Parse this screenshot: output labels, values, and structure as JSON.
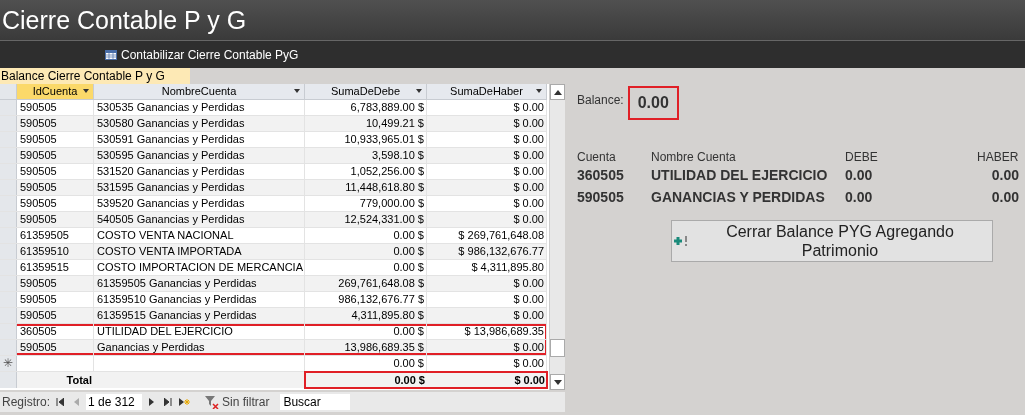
{
  "window": {
    "title": "Cierre Contable P y G"
  },
  "toolbar": {
    "button": "Contabilizar Cierre Contable PyG"
  },
  "form_tab": {
    "label": "Balance Cierre Contable P y G"
  },
  "table": {
    "columns": [
      {
        "label": "IdCuenta",
        "selected": true
      },
      {
        "label": "NombreCuenta",
        "selected": false
      },
      {
        "label": "SumaDeDebe",
        "selected": false
      },
      {
        "label": "SumaDeHaber",
        "selected": false
      }
    ],
    "rows": [
      {
        "cells": [
          "590505",
          "530535 Ganancias y Perdidas",
          "6,783,889.00 $",
          "$ 0.00"
        ],
        "highlighted": false
      },
      {
        "cells": [
          "590505",
          "530580 Ganancias y Perdidas",
          "10,499.21 $",
          "$ 0.00"
        ],
        "highlighted": false
      },
      {
        "cells": [
          "590505",
          "530591 Ganancias y Perdidas",
          "10,933,965.01 $",
          "$ 0.00"
        ],
        "highlighted": false
      },
      {
        "cells": [
          "590505",
          "530595 Ganancias y Perdidas",
          "3,598.10 $",
          "$ 0.00"
        ],
        "highlighted": false
      },
      {
        "cells": [
          "590505",
          "531520 Ganancias y Perdidas",
          "1,052,256.00 $",
          "$ 0.00"
        ],
        "highlighted": false
      },
      {
        "cells": [
          "590505",
          "531595 Ganancias y Perdidas",
          "11,448,618.80 $",
          "$ 0.00"
        ],
        "highlighted": false
      },
      {
        "cells": [
          "590505",
          "539520 Ganancias y Perdidas",
          "779,000.00 $",
          "$ 0.00"
        ],
        "highlighted": false
      },
      {
        "cells": [
          "590505",
          "540505 Ganancias y Perdidas",
          "12,524,331.00 $",
          "$ 0.00"
        ],
        "highlighted": false
      },
      {
        "cells": [
          "61359505",
          "COSTO VENTA NACIONAL",
          "0.00 $",
          "$ 269,761,648.08"
        ],
        "highlighted": false
      },
      {
        "cells": [
          "61359510",
          "COSTO VENTA IMPORTADA",
          "0.00 $",
          "$ 986,132,676.77"
        ],
        "highlighted": false
      },
      {
        "cells": [
          "61359515",
          "COSTO IMPORTACION DE MERCANCIA",
          "0.00 $",
          "$ 4,311,895.80"
        ],
        "highlighted": false
      },
      {
        "cells": [
          "590505",
          "61359505 Ganancias y Perdidas",
          "269,761,648.08 $",
          "$ 0.00"
        ],
        "highlighted": false
      },
      {
        "cells": [
          "590505",
          "61359510 Ganancias y Perdidas",
          "986,132,676.77 $",
          "$ 0.00"
        ],
        "highlighted": false
      },
      {
        "cells": [
          "590505",
          "61359515 Ganancias y Perdidas",
          "4,311,895.80 $",
          "$ 0.00"
        ],
        "highlighted": false
      },
      {
        "cells": [
          "360505",
          "UTILIDAD DEL EJERCICIO",
          "0.00 $",
          "$ 13,986,689.35"
        ],
        "highlighted": true
      },
      {
        "cells": [
          "590505",
          "Ganancias y Perdidas",
          "13,986,689.35 $",
          "$ 0.00"
        ],
        "highlighted": true
      }
    ],
    "new_row": {
      "marker": "✳",
      "cells": [
        "0.00 $",
        "$ 0.00"
      ]
    },
    "total": {
      "label": "Total",
      "debe": "0.00 $",
      "haber": "$ 0.00",
      "highlighted": true
    }
  },
  "navigation": {
    "label": "Registro:",
    "position": "1 de 312",
    "filter": "Sin filtrar",
    "search": "Buscar"
  },
  "balance": {
    "label": "Balance:",
    "value": "0.00",
    "highlighted": true
  },
  "summary": {
    "columns": [
      "Cuenta",
      "Nombre Cuenta",
      "DEBE",
      "HABER"
    ],
    "rows": [
      [
        "360505",
        "UTILIDAD DEL EJERCICIO",
        "0.00",
        "0.00"
      ],
      [
        "590505",
        "GANANCIAS Y PERDIDAS",
        "0.00",
        "0.00"
      ]
    ]
  },
  "action_button": {
    "label": "Cerrar Balance PYG Agregando Patrimonio"
  }
}
